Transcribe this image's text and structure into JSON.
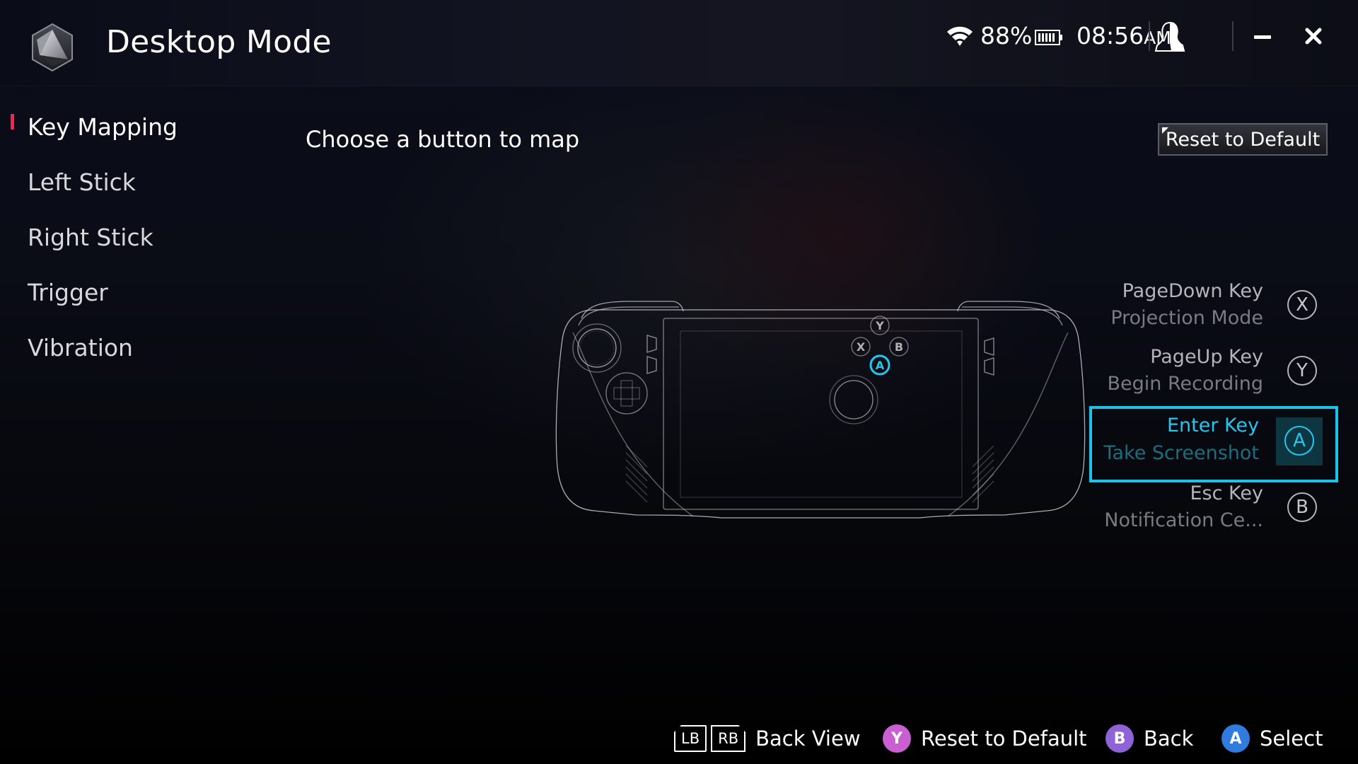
{
  "header": {
    "title": "Desktop Mode",
    "wifi_icon": "wifi-icon",
    "battery_percent": "88%",
    "battery_icon": "battery-icon",
    "time": "08:56",
    "time_suffix": "AM",
    "profile_icon": "user-profile-icon",
    "minimize_icon": "minimize-icon",
    "close_icon": "close-icon"
  },
  "sidebar": {
    "items": [
      {
        "label": "Key Mapping",
        "active": true
      },
      {
        "label": "Left Stick",
        "active": false
      },
      {
        "label": "Right Stick",
        "active": false
      },
      {
        "label": "Trigger",
        "active": false
      },
      {
        "label": "Vibration",
        "active": false
      }
    ]
  },
  "main": {
    "prompt": "Choose a button to map",
    "reset_button": "Reset to Default",
    "device_image": "handheld-console-outline",
    "highlighted_device_button": "A",
    "mappings": [
      {
        "key": "PageDown Key",
        "action": "Projection Mode",
        "button": "X",
        "selected": false
      },
      {
        "key": "PageUp Key",
        "action": "Begin Recording",
        "button": "Y",
        "selected": false
      },
      {
        "key": "Enter Key",
        "action": "Take Screenshot",
        "button": "A",
        "selected": true
      },
      {
        "key": "Esc Key",
        "action": "Notification Ce...",
        "button": "B",
        "selected": false
      }
    ]
  },
  "footer": {
    "hints": [
      {
        "buttons": [
          "LB",
          "RB"
        ],
        "label": "Back View"
      },
      {
        "button": "Y",
        "label": "Reset to Default",
        "color": "#c95fd0"
      },
      {
        "button": "B",
        "label": "Back",
        "color": "#8f62d8"
      },
      {
        "button": "A",
        "label": "Select",
        "color": "#2f7be0"
      }
    ]
  },
  "colors": {
    "accent_active": "#ff1f4e",
    "selection": "#19c3ea",
    "selection_bg": "#0d3640"
  }
}
